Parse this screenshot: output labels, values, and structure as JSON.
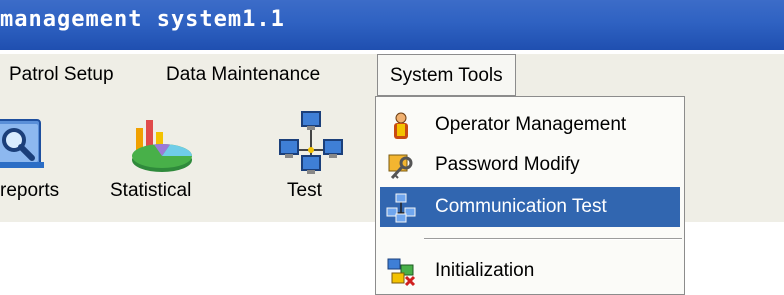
{
  "window": {
    "title": "management system1.1"
  },
  "menu": {
    "items": [
      {
        "label": "Patrol Setup"
      },
      {
        "label": "Data Maintenance"
      },
      {
        "label": "System Tools"
      }
    ]
  },
  "toolbar": {
    "buttons": [
      {
        "label": "reports",
        "icon": "search-report-icon"
      },
      {
        "label": "Statistical",
        "icon": "pie-chart-icon"
      },
      {
        "label": "Test",
        "icon": "network-computers-icon"
      }
    ]
  },
  "dropdown": {
    "items": [
      {
        "label": "Operator Management",
        "icon": "operator-icon"
      },
      {
        "label": "Password Modify",
        "icon": "key-icon"
      },
      {
        "label": "Communication Test",
        "icon": "network-computers-icon",
        "selected": true
      },
      {
        "label": "Initialization",
        "icon": "initialization-icon"
      }
    ]
  },
  "colors": {
    "title_bar": "#2f62c2",
    "menu_bg": "#efeee6",
    "selection": "#3166b0"
  }
}
